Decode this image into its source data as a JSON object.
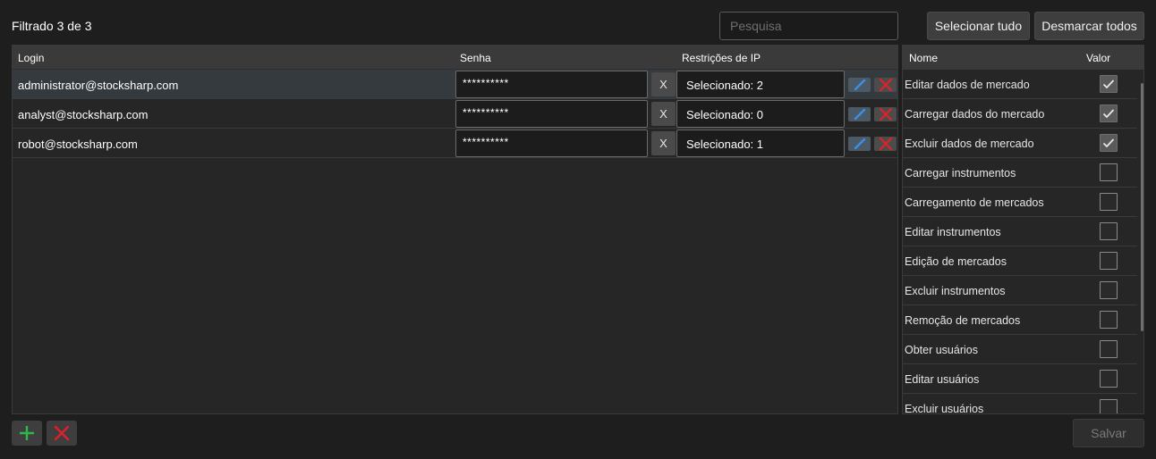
{
  "header": {
    "filter_status": "Filtrado 3 de 3",
    "search_placeholder": "Pesquisa",
    "select_all_label": "Selecionar tudo",
    "deselect_all_label": "Desmarcar todos"
  },
  "users": {
    "columns": {
      "login": "Login",
      "password": "Senha",
      "ip_restrictions": "Restrições de IP"
    },
    "rows": [
      {
        "login": "administrator@stocksharp.com",
        "password": "**********",
        "clear": "X",
        "ip": "Selecionado: 2",
        "selected": true
      },
      {
        "login": "analyst@stocksharp.com",
        "password": "**********",
        "clear": "X",
        "ip": "Selecionado: 0",
        "selected": false
      },
      {
        "login": "robot@stocksharp.com",
        "password": "**********",
        "clear": "X",
        "ip": "Selecionado: 1",
        "selected": false
      }
    ]
  },
  "permissions": {
    "columns": {
      "name": "Nome",
      "value": "Valor"
    },
    "rows": [
      {
        "name": "Editar dados de mercado",
        "checked": true
      },
      {
        "name": "Carregar dados do mercado",
        "checked": true
      },
      {
        "name": "Excluir dados de mercado",
        "checked": true
      },
      {
        "name": "Carregar instrumentos",
        "checked": false
      },
      {
        "name": "Carregamento de mercados",
        "checked": false
      },
      {
        "name": "Editar instrumentos",
        "checked": false
      },
      {
        "name": "Edição de mercados",
        "checked": false
      },
      {
        "name": "Excluir instrumentos",
        "checked": false
      },
      {
        "name": "Remoção de mercados",
        "checked": false
      },
      {
        "name": "Obter usuários",
        "checked": false
      },
      {
        "name": "Editar usuários",
        "checked": false
      },
      {
        "name": "Excluir usuários",
        "checked": false
      }
    ]
  },
  "footer": {
    "save_label": "Salvar"
  },
  "icons": {
    "add": "plus-icon",
    "remove": "close-icon",
    "edit": "pencil-icon",
    "delete": "close-icon",
    "check": "check-icon"
  },
  "colors": {
    "accent_green": "#2fb84a",
    "danger_red": "#e0202a",
    "edit_blue": "#2f7fd6"
  }
}
